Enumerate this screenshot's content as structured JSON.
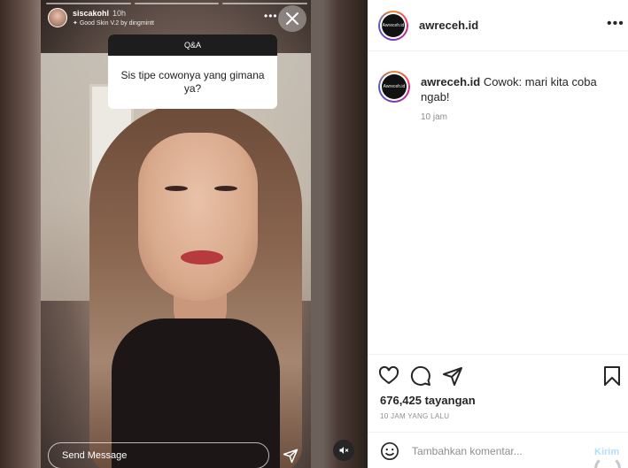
{
  "story": {
    "username": "siscakohl",
    "time": "10h",
    "filter": "Good Skin V.2 by dingmintt",
    "qa_title": "Q&A",
    "question": "Sis tipe cowonya yang gimana ya?",
    "send_placeholder": "Send Message",
    "progress_segments": 3
  },
  "post": {
    "account": "awreceh.id",
    "avatar_text": "Awreceh.id",
    "caption_user": "awreceh.id",
    "caption_text": " Cowok: mari kita coba ngab!",
    "caption_time": "10 jam",
    "views": "676,425 tayangan",
    "posted_ago": "10 JAM YANG LALU",
    "comment_placeholder": "Tambahkan komentar...",
    "post_button": "Kirim"
  },
  "icons": [
    "close-icon",
    "more-icon",
    "send-icon",
    "mute-icon",
    "heart-icon",
    "comment-icon",
    "share-icon",
    "bookmark-icon",
    "emoji-icon"
  ],
  "colors": {
    "text": "#262626",
    "muted": "#8e8e8e",
    "post_disabled": "#b2dffc"
  }
}
